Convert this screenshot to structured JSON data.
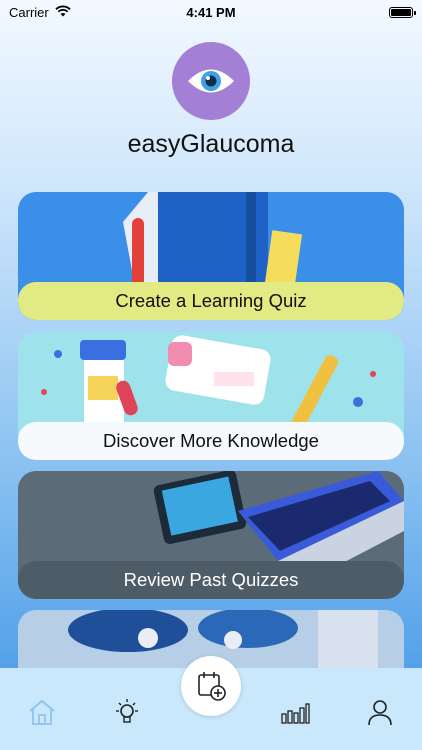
{
  "status": {
    "carrier": "Carrier",
    "time": "4:41 PM"
  },
  "app": {
    "title": "easyGlaucoma"
  },
  "cards": [
    {
      "label": "Create a Learning Quiz"
    },
    {
      "label": "Discover More Knowledge"
    },
    {
      "label": "Review Past Quizzes"
    }
  ],
  "tabbar": {
    "items": [
      "home-icon",
      "lightbulb-icon",
      "add-quiz-icon",
      "bar-chart-icon",
      "profile-icon"
    ]
  },
  "colors": {
    "logo_bg": "#a47fd6",
    "card1_label_bg": "#e1ea83",
    "tabbar_bg": "#c9e8fb",
    "accent": "#3d93e6"
  }
}
